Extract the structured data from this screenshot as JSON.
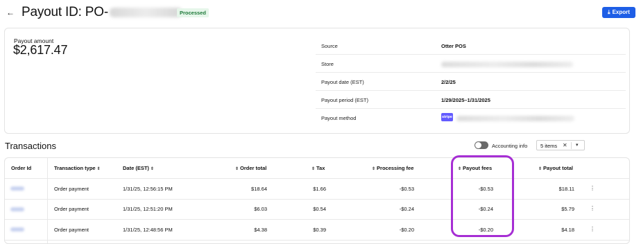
{
  "header": {
    "title": "Payout ID: PO-",
    "status": "Processed",
    "export_label": "Export",
    "accent": "#1e5ee6",
    "status_color": "#1f7a3a"
  },
  "summary": {
    "amount_label": "Payout amount",
    "amount": "$2,617.47",
    "details": [
      {
        "key": "Source",
        "value": "Otter POS"
      },
      {
        "key": "Store",
        "value": ""
      },
      {
        "key": "Payout date (EST)",
        "value": "2/2/25"
      },
      {
        "key": "Payout period (EST)",
        "value": "1/29/2025–1/31/2025"
      },
      {
        "key": "Payout method",
        "value": "",
        "logo": "stripe"
      }
    ]
  },
  "transactions": {
    "title": "Transactions",
    "accounting_info_label": "Accounting info",
    "filter_value": "5 items",
    "columns": [
      "Order Id",
      "Transaction type",
      "Date (EST)",
      "Order total",
      "Tax",
      "Processing fee",
      "Payout fees",
      "Payout total"
    ],
    "rows": [
      {
        "type": "Order payment",
        "date": "1/31/25, 12:56:15 PM",
        "order_total": "$18.64",
        "tax": "$1.66",
        "processing_fee": "-$0.53",
        "payout_fees": "-$0.53",
        "payout_total": "$18.11"
      },
      {
        "type": "Order payment",
        "date": "1/31/25, 12:51:20 PM",
        "order_total": "$6.03",
        "tax": "$0.54",
        "processing_fee": "-$0.24",
        "payout_fees": "-$0.24",
        "payout_total": "$5.79"
      },
      {
        "type": "Order payment",
        "date": "1/31/25, 12:48:56 PM",
        "order_total": "$4.38",
        "tax": "$0.39",
        "processing_fee": "-$0.20",
        "payout_fees": "-$0.20",
        "payout_total": "$4.18"
      }
    ],
    "highlight_color": "#a62ed4"
  }
}
